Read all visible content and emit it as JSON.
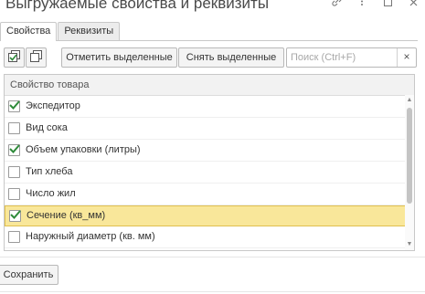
{
  "window": {
    "title": "Выгружаемые свойства и реквизиты",
    "icons": [
      "link-icon",
      "more-icon",
      "maximize-icon",
      "close-icon"
    ]
  },
  "tabs": [
    {
      "label": "Свойства",
      "active": true
    },
    {
      "label": "Реквизиты",
      "active": false
    }
  ],
  "toolbar": {
    "check_all_icon": "check-all-icon",
    "copy_icon": "copy-icon",
    "mark_selected_label": "Отметить выделенные",
    "unmark_selected_label": "Снять выделенные",
    "search_placeholder": "Поиск (Ctrl+F)",
    "search_value": "",
    "clear_label": "×"
  },
  "table": {
    "column_header": "Свойство товара",
    "rows": [
      {
        "label": "Экспедитор",
        "checked": true,
        "selected": false
      },
      {
        "label": "Вид сока",
        "checked": false,
        "selected": false
      },
      {
        "label": "Объем упаковки (литры)",
        "checked": true,
        "selected": false
      },
      {
        "label": "Тип хлеба",
        "checked": false,
        "selected": false
      },
      {
        "label": "Число жил",
        "checked": false,
        "selected": false
      },
      {
        "label": "Сечение (кв_мм)",
        "checked": true,
        "selected": true
      },
      {
        "label": "Наружный диаметр (кв. мм)",
        "checked": false,
        "selected": false
      }
    ]
  },
  "footer": {
    "save_label": "Сохранить"
  },
  "colors": {
    "check": "#2e8b3a",
    "selected_row": "#f9e79a",
    "selected_border": "#e0c050"
  }
}
